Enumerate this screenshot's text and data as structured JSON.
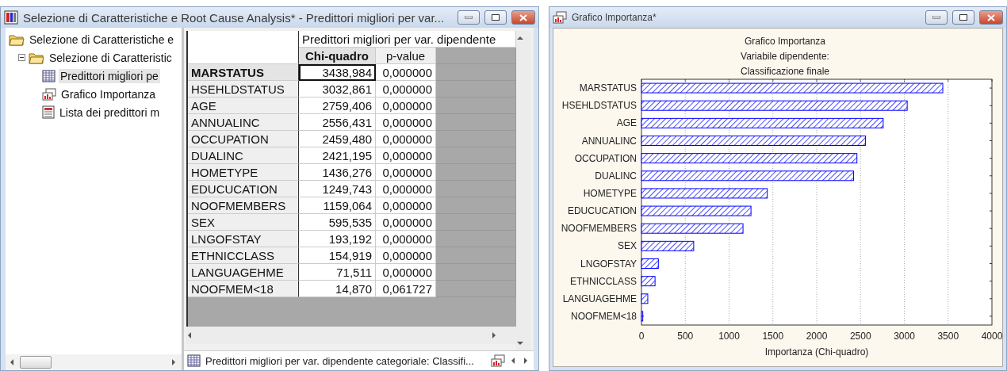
{
  "left_window": {
    "title": "Selezione di Caratteristiche e Root Cause Analysis* - Predittori migliori per var...",
    "tree": [
      {
        "label": "Selezione di Caratteristiche e",
        "children": [
          {
            "label": "Selezione di Caratteristic",
            "expanded": true,
            "children": [
              {
                "label": "Predittori migliori pe",
                "kind": "table",
                "selected": true
              },
              {
                "label": "Grafico Importanza",
                "kind": "chart",
                "selected": false
              },
              {
                "label": "Lista dei predittori m",
                "kind": "list",
                "selected": false
              }
            ]
          }
        ]
      }
    ],
    "table": {
      "group_header": "Predittori migliori per var. dipendente",
      "columns": [
        {
          "label": "Chi-quadro",
          "selected": true
        },
        {
          "label": "p-value",
          "selected": false
        }
      ],
      "rows": [
        {
          "name": "MARSTATUS",
          "chi_quadro": "3438,984",
          "p_value": "0,000000",
          "selected": true
        },
        {
          "name": "HSEHLDSTATUS",
          "chi_quadro": "3032,861",
          "p_value": "0,000000",
          "selected": false
        },
        {
          "name": "AGE",
          "chi_quadro": "2759,406",
          "p_value": "0,000000",
          "selected": false
        },
        {
          "name": "ANNUALINC",
          "chi_quadro": "2556,431",
          "p_value": "0,000000",
          "selected": false
        },
        {
          "name": "OCCUPATION",
          "chi_quadro": "2459,480",
          "p_value": "0,000000",
          "selected": false
        },
        {
          "name": "DUALINC",
          "chi_quadro": "2421,195",
          "p_value": "0,000000",
          "selected": false
        },
        {
          "name": "HOMETYPE",
          "chi_quadro": "1436,276",
          "p_value": "0,000000",
          "selected": false
        },
        {
          "name": "EDUCUCATION",
          "chi_quadro": "1249,743",
          "p_value": "0,000000",
          "selected": false
        },
        {
          "name": "NOOFMEMBERS",
          "chi_quadro": "1159,064",
          "p_value": "0,000000",
          "selected": false
        },
        {
          "name": "SEX",
          "chi_quadro": "595,535",
          "p_value": "0,000000",
          "selected": false
        },
        {
          "name": "LNGOFSTAY",
          "chi_quadro": "193,192",
          "p_value": "0,000000",
          "selected": false
        },
        {
          "name": "ETHNICCLASS",
          "chi_quadro": "154,919",
          "p_value": "0,000000",
          "selected": false
        },
        {
          "name": "LANGUAGEHME",
          "chi_quadro": "71,511",
          "p_value": "0,000000",
          "selected": false
        },
        {
          "name": "NOOFMEM<18",
          "chi_quadro": "14,870",
          "p_value": "0,061727",
          "selected": false
        }
      ]
    },
    "status_text": "Predittori migliori per var. dipendente categoriale: Classifi..."
  },
  "right_window": {
    "title": "Grafico Importanza*",
    "chart_subtitle": [
      "Variabile dipendente:",
      "Classificazione finale"
    ],
    "chart_data": {
      "type": "bar",
      "orientation": "horizontal",
      "title": "Grafico Importanza",
      "xlabel": "Importanza (Chi-quadro)",
      "categories": [
        "MARSTATUS",
        "HSEHLDSTATUS",
        "AGE",
        "ANNUALINC",
        "OCCUPATION",
        "DUALINC",
        "HOMETYPE",
        "EDUCUCATION",
        "NOOFMEMBERS",
        "SEX",
        "LNGOFSTAY",
        "ETHNICCLASS",
        "LANGUAGEHME",
        "NOOFMEM<18"
      ],
      "series": [
        {
          "color": "#0000ff",
          "values": [
            3439,
            3033,
            2759,
            2556,
            2459,
            2421,
            1436,
            1250,
            1159,
            596,
            193,
            155,
            72,
            15
          ]
        }
      ],
      "grid": true,
      "xlim": [
        0,
        4000
      ],
      "xticks": [
        0,
        500,
        1000,
        1500,
        2000,
        2500,
        3000,
        3500,
        4000
      ]
    }
  }
}
